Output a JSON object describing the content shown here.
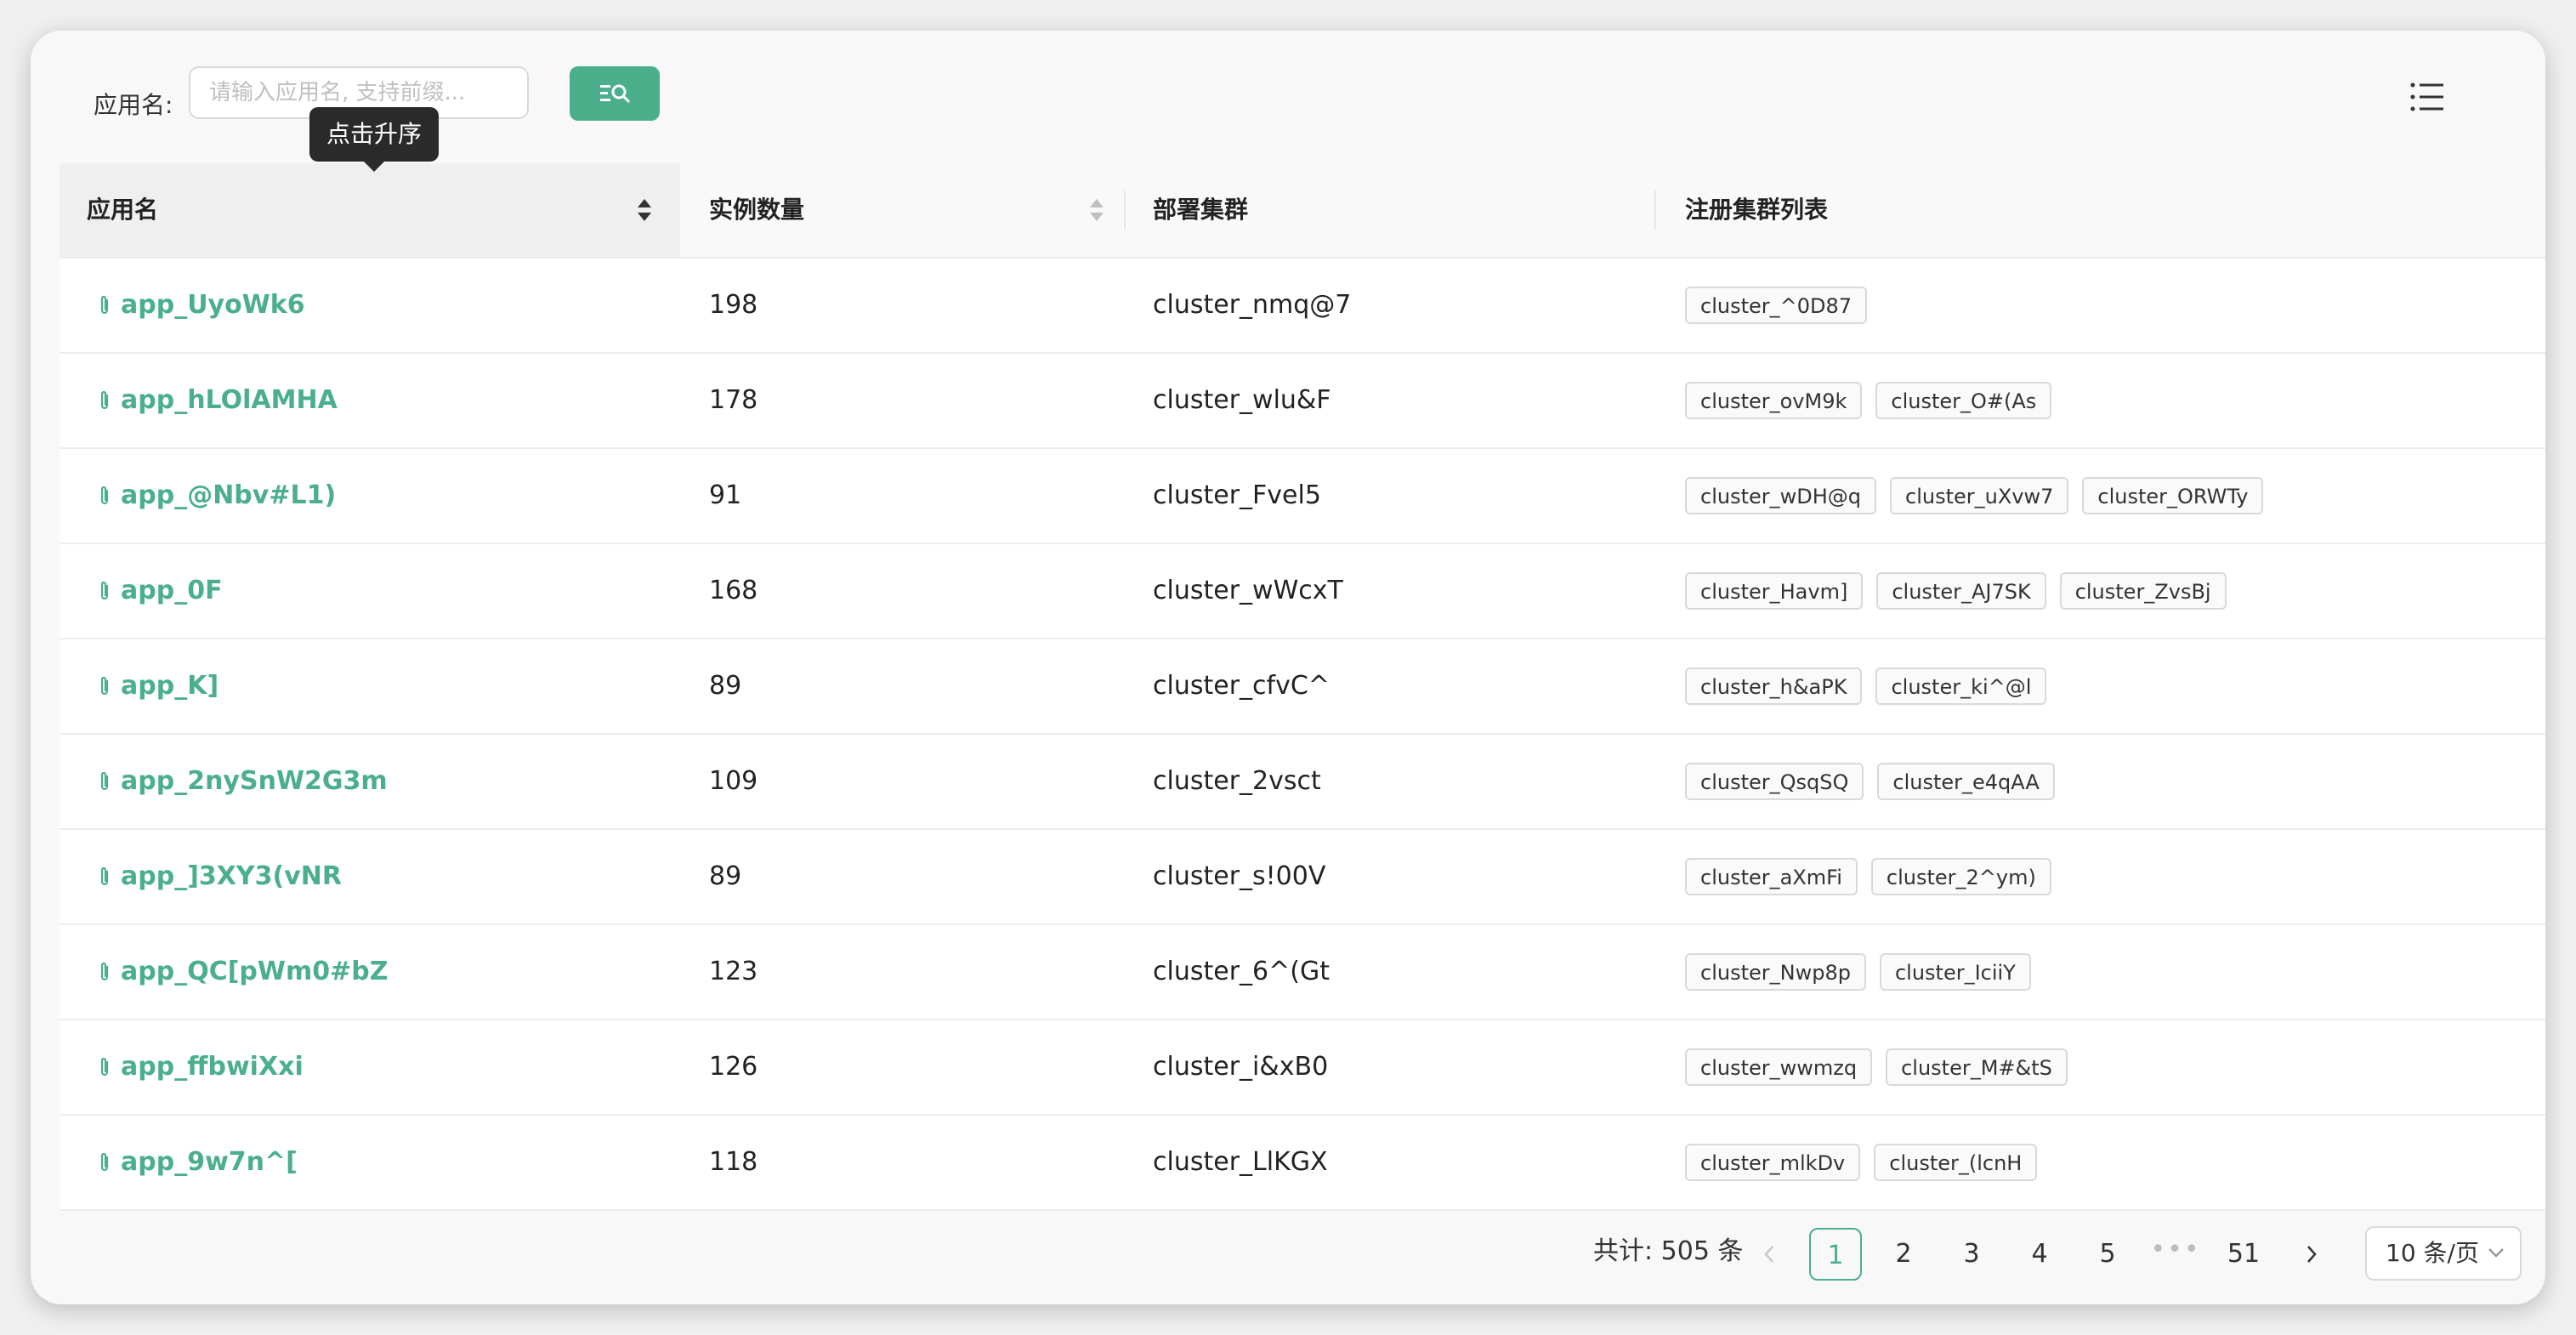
{
  "filter": {
    "label": "应用名:",
    "placeholder": "请输入应用名, 支持前缀...",
    "value": ""
  },
  "tooltip": "点击升序",
  "columns": [
    "应用名",
    "实例数量",
    "部署集群",
    "注册集群列表"
  ],
  "rows": [
    {
      "app": "app_UyoWk6",
      "instances": "198",
      "deploy": "cluster_nmq@7",
      "registered": [
        "cluster_^0D87"
      ]
    },
    {
      "app": "app_hLOlAMHA",
      "instances": "178",
      "deploy": "cluster_wlu&F",
      "registered": [
        "cluster_ovM9k",
        "cluster_O#(As"
      ]
    },
    {
      "app": "app_@Nbv#L1)",
      "instances": "91",
      "deploy": "cluster_Fvel5",
      "registered": [
        "cluster_wDH@q",
        "cluster_uXvw7",
        "cluster_ORWTy"
      ]
    },
    {
      "app": "app_0F",
      "instances": "168",
      "deploy": "cluster_wWcxT",
      "registered": [
        "cluster_Havm]",
        "cluster_AJ7SK",
        "cluster_ZvsBj"
      ]
    },
    {
      "app": "app_K]",
      "instances": "89",
      "deploy": "cluster_cfvC^",
      "registered": [
        "cluster_h&aPK",
        "cluster_ki^@l"
      ]
    },
    {
      "app": "app_2nySnW2G3m",
      "instances": "109",
      "deploy": "cluster_2vsct",
      "registered": [
        "cluster_QsqSQ",
        "cluster_e4qAA"
      ]
    },
    {
      "app": "app_]3XY3(vNR",
      "instances": "89",
      "deploy": "cluster_s!00V",
      "registered": [
        "cluster_aXmFi",
        "cluster_2^ym)"
      ]
    },
    {
      "app": "app_QC[pWm0#bZ",
      "instances": "123",
      "deploy": "cluster_6^(Gt",
      "registered": [
        "cluster_Nwp8p",
        "cluster_IciiY"
      ]
    },
    {
      "app": "app_ffbwiXxi",
      "instances": "126",
      "deploy": "cluster_i&xB0",
      "registered": [
        "cluster_wwmzq",
        "cluster_M#&tS"
      ]
    },
    {
      "app": "app_9w7n^[",
      "instances": "118",
      "deploy": "cluster_LlKGX",
      "registered": [
        "cluster_mlkDv",
        "cluster_(lcnH"
      ]
    }
  ],
  "pagination": {
    "total_text": "共计: 505 条",
    "pages": [
      "1",
      "2",
      "3",
      "4",
      "5"
    ],
    "last_page": "51",
    "active": "1",
    "page_size": "10 条/页"
  },
  "colors": {
    "accent": "#4caf8c"
  }
}
